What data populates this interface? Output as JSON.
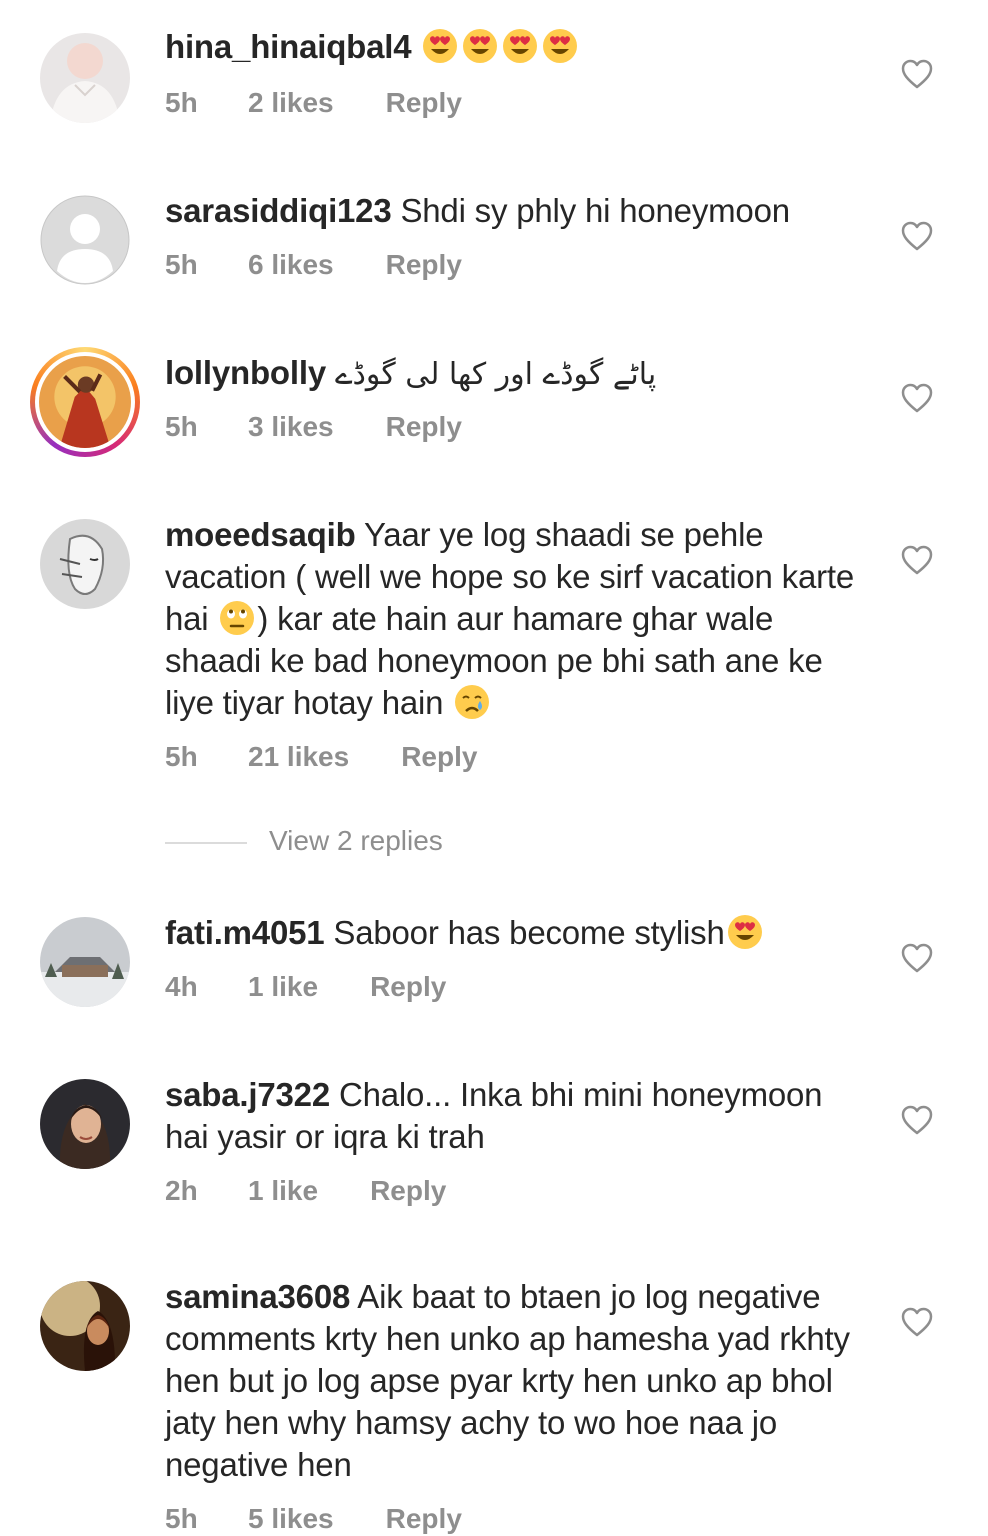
{
  "comments": [
    {
      "username": "hina_hinaiqbal4",
      "text": "",
      "emojis": [
        "heart-eyes-emoji",
        "heart-eyes-emoji",
        "heart-eyes-emoji",
        "heart-eyes-emoji"
      ],
      "time": "5h",
      "likes": "2 likes",
      "reply": "Reply"
    },
    {
      "username": "sarasiddiqi123",
      "text": "Shdi sy phly hi honeymoon",
      "time": "5h",
      "likes": "6 likes",
      "reply": "Reply"
    },
    {
      "username": "lollynbolly",
      "text": "پاٹے گوڈے اور کھا لی گوڈے",
      "time": "5h",
      "likes": "3 likes",
      "reply": "Reply"
    },
    {
      "username": "moeedsaqib",
      "text_part1": "Yaar ye log shaadi se pehle vacation ( well we hope so ke sirf vacation karte hai",
      "text_part2": ") kar ate hain aur hamare ghar wale shaadi ke bad honeymoon pe bhi sath ane ke liye tiyar hotay hain",
      "emojis": [
        "eye-roll-emoji",
        "crying-emoji"
      ],
      "time": "5h",
      "likes": "21 likes",
      "reply": "Reply",
      "view_replies": "View 2 replies"
    },
    {
      "username": "fati.m4051",
      "text": "Saboor has become stylish",
      "emojis": [
        "heart-eyes-emoji"
      ],
      "time": "4h",
      "likes": "1 like",
      "reply": "Reply"
    },
    {
      "username": "saba.j7322",
      "text": "Chalo... Inka bhi mini honeymoon hai yasir or iqra ki trah",
      "time": "2h",
      "likes": "1 like",
      "reply": "Reply"
    },
    {
      "username": "samina3608",
      "text": "Aik baat to btaen jo log negative comments krty hen unko ap hamesha yad rkhty hen but jo log apse pyar krty hen unko ap bhol jaty hen why hamsy achy to wo hoe naa jo negative hen",
      "time": "5h",
      "likes": "5 likes",
      "reply": "Reply"
    }
  ],
  "colors": {
    "text": "#262626",
    "meta": "#8e8e8e",
    "divider": "#dbdbdb",
    "story_ring": "#d62976"
  }
}
